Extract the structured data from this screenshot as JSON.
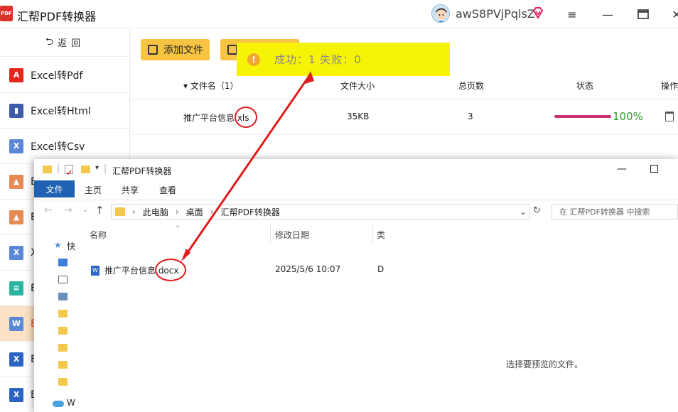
{
  "app": {
    "logo_text": "PDF",
    "title": "汇帮PDF转换器",
    "username": "awS8PVjPqlsZ"
  },
  "sidebar": {
    "back_label": "返回",
    "items": [
      {
        "label": "Excel转Pdf",
        "icon": "pdf-icon",
        "color": "#e8251c",
        "glyph": "A"
      },
      {
        "label": "Excel转Html",
        "icon": "html-book-icon",
        "color": "#3e5ba9",
        "glyph": "▮"
      },
      {
        "label": "Excel转Csv",
        "icon": "csv-icon",
        "color": "#5a87d6",
        "glyph": "X"
      },
      {
        "label": "E",
        "icon": "image-icon",
        "color": "#e58a52",
        "glyph": "▲"
      },
      {
        "label": "E",
        "icon": "image-icon",
        "color": "#e58a52",
        "glyph": "▲"
      },
      {
        "label": "X",
        "icon": "excel-x-icon",
        "color": "#5a87d6",
        "glyph": "X"
      },
      {
        "label": "E",
        "icon": "text-icon",
        "color": "#2bb5a0",
        "glyph": "≡"
      },
      {
        "label": "E",
        "icon": "word-icon",
        "color": "#5a87d6",
        "glyph": "W",
        "active": true
      },
      {
        "label": "E",
        "icon": "excel-icon",
        "color": "#2a63c2",
        "glyph": "X"
      },
      {
        "label": "E",
        "icon": "excel-icon",
        "color": "#2a63c2",
        "glyph": "X"
      }
    ]
  },
  "toolbar": {
    "add_file": "添加文件"
  },
  "table": {
    "headers": {
      "name": "▾ 文件名（1）",
      "size": "文件大小",
      "pages": "总页数",
      "status": "状态",
      "ops": "操作"
    },
    "row": {
      "name": "推广平台信息.xls",
      "size": "35KB",
      "pages": "3",
      "progress": 1.0,
      "percent": "100%"
    }
  },
  "toast": {
    "text": "成功：1   失败：0"
  },
  "explorer": {
    "title": "汇帮PDF转换器",
    "tabs": {
      "file": "文件",
      "home": "主页",
      "share": "共享",
      "view": "查看"
    },
    "breadcrumb": [
      "此电脑",
      "桌面",
      "汇帮PDF转换器"
    ],
    "search_placeholder": "在 汇帮PDF转换器 中搜索",
    "nav": {
      "quick": "快",
      "w": "W"
    },
    "columns": {
      "name": "名称",
      "modified": "修改日期",
      "type": "类"
    },
    "file": {
      "name": "推广平台信息.docx",
      "modified": "2025/5/6 10:07",
      "type": "D"
    },
    "preview_text": "选择要预览的文件。"
  },
  "colors": {
    "accent_yellow": "#f6c343",
    "toast_yellow": "#f7f307",
    "progress": "#c8346e",
    "success_green": "#2f9a2f",
    "annotation_red": "#e01b1b",
    "explorer_blue": "#1f62b3"
  }
}
